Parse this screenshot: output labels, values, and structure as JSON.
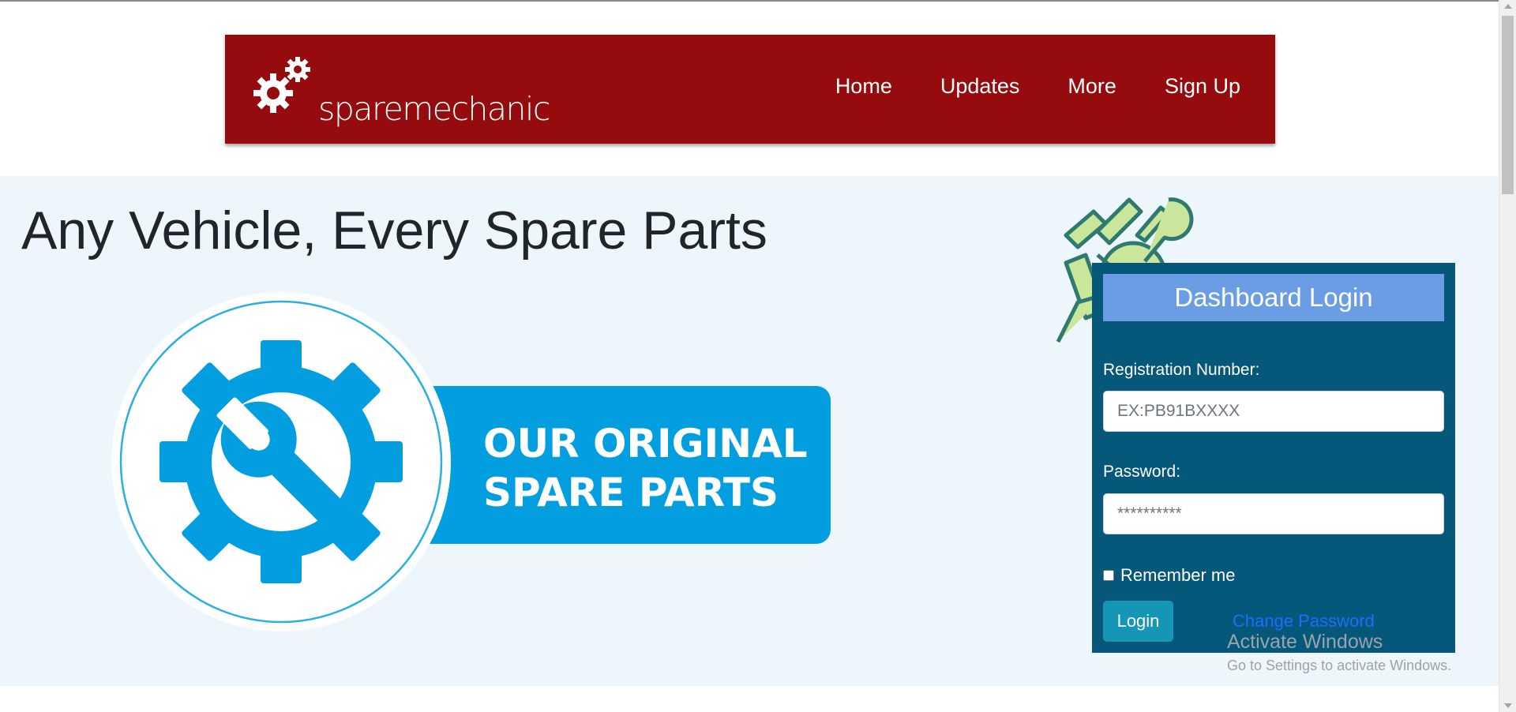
{
  "brand": {
    "name": "sparemechanic"
  },
  "nav": {
    "items": [
      "Home",
      "Updates",
      "More",
      "Sign Up"
    ]
  },
  "hero": {
    "headline": "Any Vehicle, Every Spare Parts",
    "badge": {
      "line1": "OUR ORIGINAL",
      "line2": "SPARE PARTS"
    }
  },
  "login": {
    "title": "Dashboard Login",
    "reg_label": "Registration Number:",
    "reg_placeholder": "EX:PB91BXXXX",
    "password_label": "Password:",
    "password_placeholder": "**********",
    "remember_label": "Remember me",
    "login_button": "Login",
    "change_password": "Change Password"
  },
  "watermark": {
    "line1": "Activate Windows",
    "line2": "Go to Settings to activate Windows."
  },
  "colors": {
    "navbar": "#960b0d",
    "hero_bg": "#eef6fd",
    "login_panel": "#06587a",
    "login_title": "#6a9de3",
    "login_button": "#1696b6",
    "link": "#1a6efe",
    "badge_blue": "#029ee0"
  },
  "icons": [
    "gears-logo-icon",
    "gear-wrench-icon",
    "tools-illustration-icon"
  ]
}
